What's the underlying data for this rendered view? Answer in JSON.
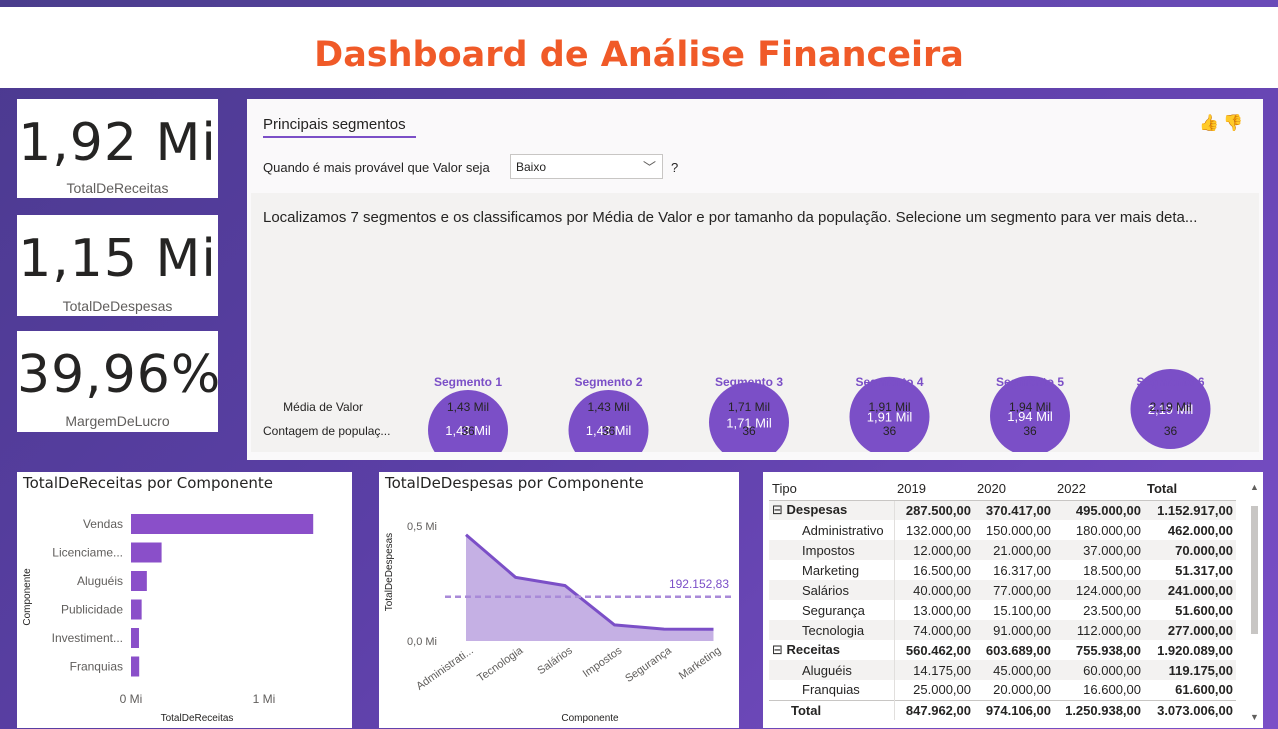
{
  "page": {
    "title": "Dashboard de Análise Financeira"
  },
  "kpis": [
    {
      "value": "1,92 Mi",
      "label": "TotalDeReceitas"
    },
    {
      "value": "1,15 Mi",
      "label": "TotalDeDespesas"
    },
    {
      "value": "39,96%",
      "label": "MargemDeLucro"
    }
  ],
  "segments_panel": {
    "tab": "Principais segmentos",
    "question": "Quando é mais provável que Valor seja",
    "dropdown_value": "Baixo",
    "question_mark": "?",
    "description": "Localizamos 7 segmentos e os classificamos por Média de Valor e por tamanho da população. Selecione um segmento para ver mais deta...",
    "row_labels": [
      "Média de Valor",
      "Contagem de populaç..."
    ],
    "segments": [
      {
        "name": "Segmento 1",
        "bubble": "1,43 Mil",
        "media": "1,43 Mil",
        "contagem": "36",
        "value": 1430
      },
      {
        "name": "Segmento 2",
        "bubble": "1,43 Mil",
        "media": "1,43 Mil",
        "contagem": "36",
        "value": 1430
      },
      {
        "name": "Segmento 3",
        "bubble": "1,71 Mil",
        "media": "1,71 Mil",
        "contagem": "36",
        "value": 1710
      },
      {
        "name": "Segmento 4",
        "bubble": "1,91 Mil",
        "media": "1,91 Mil",
        "contagem": "36",
        "value": 1910
      },
      {
        "name": "Segmento 5",
        "bubble": "1,94 Mil",
        "media": "1,94 Mil",
        "contagem": "36",
        "value": 1940
      },
      {
        "name": "Segmento 6",
        "bubble": "2,19 Mil",
        "media": "2,19 Mil",
        "contagem": "36",
        "value": 2190
      }
    ],
    "accent": "#7b4fc7"
  },
  "chart_data": [
    {
      "type": "bar",
      "title": "TotalDeReceitas por Componente",
      "xlabel": "TotalDeReceitas",
      "ylabel": "Componente",
      "categories": [
        "Vendas",
        "Licenciame...",
        "Aluguéis",
        "Publicidade",
        "Investiment...",
        "Franquias"
      ],
      "values": [
        1370000,
        230000,
        119175,
        80000,
        60000,
        61600
      ],
      "xlim": [
        0,
        1200000
      ],
      "ticks": [
        {
          "v": 0,
          "label": "0 Mi"
        },
        {
          "v": 1000000,
          "label": "1 Mi"
        }
      ],
      "color": "#8a4fc9"
    },
    {
      "type": "area",
      "title": "TotalDeDespesas por Componente",
      "xlabel": "Componente",
      "ylabel": "TotalDeDespesas",
      "categories": [
        "Administrati...",
        "Tecnologia",
        "Salários",
        "Impostos",
        "Segurança",
        "Marketing"
      ],
      "values": [
        462000,
        277000,
        241000,
        70000,
        51600,
        51317
      ],
      "average": {
        "value": 192152.83,
        "label": "192.152,83"
      },
      "ylim": [
        0,
        520000
      ],
      "ticks": [
        {
          "v": 0,
          "label": "0,0 Mi"
        },
        {
          "v": 500000,
          "label": "0,5 Mi"
        }
      ],
      "color": "#7b4fc7"
    }
  ],
  "table": {
    "headers": [
      "Tipo",
      "2019",
      "2020",
      "2022",
      "Total"
    ],
    "rows": [
      {
        "kind": "group",
        "expander": "⊟",
        "cells": [
          "Despesas",
          "287.500,00",
          "370.417,00",
          "495.000,00",
          "1.152.917,00"
        ]
      },
      {
        "kind": "sub",
        "cells": [
          "Administrativo",
          "132.000,00",
          "150.000,00",
          "180.000,00",
          "462.000,00"
        ]
      },
      {
        "kind": "sub",
        "cells": [
          "Impostos",
          "12.000,00",
          "21.000,00",
          "37.000,00",
          "70.000,00"
        ]
      },
      {
        "kind": "sub",
        "cells": [
          "Marketing",
          "16.500,00",
          "16.317,00",
          "18.500,00",
          "51.317,00"
        ]
      },
      {
        "kind": "sub",
        "cells": [
          "Salários",
          "40.000,00",
          "77.000,00",
          "124.000,00",
          "241.000,00"
        ]
      },
      {
        "kind": "sub",
        "cells": [
          "Segurança",
          "13.000,00",
          "15.100,00",
          "23.500,00",
          "51.600,00"
        ]
      },
      {
        "kind": "sub",
        "cells": [
          "Tecnologia",
          "74.000,00",
          "91.000,00",
          "112.000,00",
          "277.000,00"
        ]
      },
      {
        "kind": "group",
        "expander": "⊟",
        "cells": [
          "Receitas",
          "560.462,00",
          "603.689,00",
          "755.938,00",
          "1.920.089,00"
        ]
      },
      {
        "kind": "sub",
        "cells": [
          "Aluguéis",
          "14.175,00",
          "45.000,00",
          "60.000,00",
          "119.175,00"
        ]
      },
      {
        "kind": "sub",
        "cells": [
          "Franquias",
          "25.000,00",
          "20.000,00",
          "16.600,00",
          "61.600,00"
        ]
      }
    ],
    "total": [
      "Total",
      "847.962,00",
      "974.106,00",
      "1.250.938,00",
      "3.073.006,00"
    ]
  }
}
